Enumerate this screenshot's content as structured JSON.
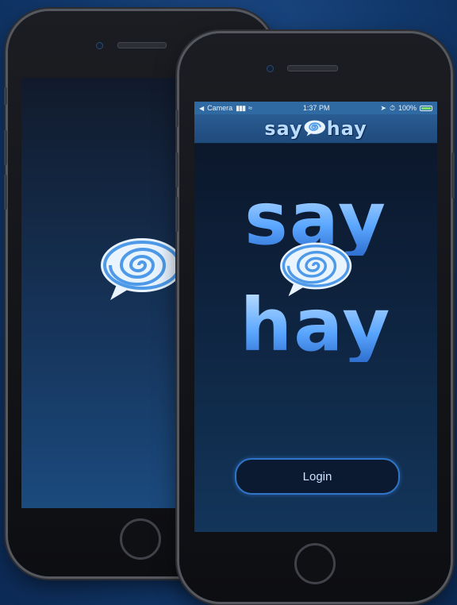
{
  "colors": {
    "background": "#123a6e",
    "accent": "#2f74c6",
    "logo_blue": "#6fb0ff",
    "battery_green": "#7ee06a"
  },
  "back_phone": {
    "splash_logo_icon": "spiral-speech-bubble-icon"
  },
  "front_phone": {
    "status_bar": {
      "back_app": "Camera",
      "time": "1:37 PM",
      "battery_percent": "100%"
    },
    "nav": {
      "title_left": "say",
      "title_right": "hay"
    },
    "logo": {
      "word_top": "say",
      "word_bottom": "hay"
    },
    "login_label": "Login"
  }
}
